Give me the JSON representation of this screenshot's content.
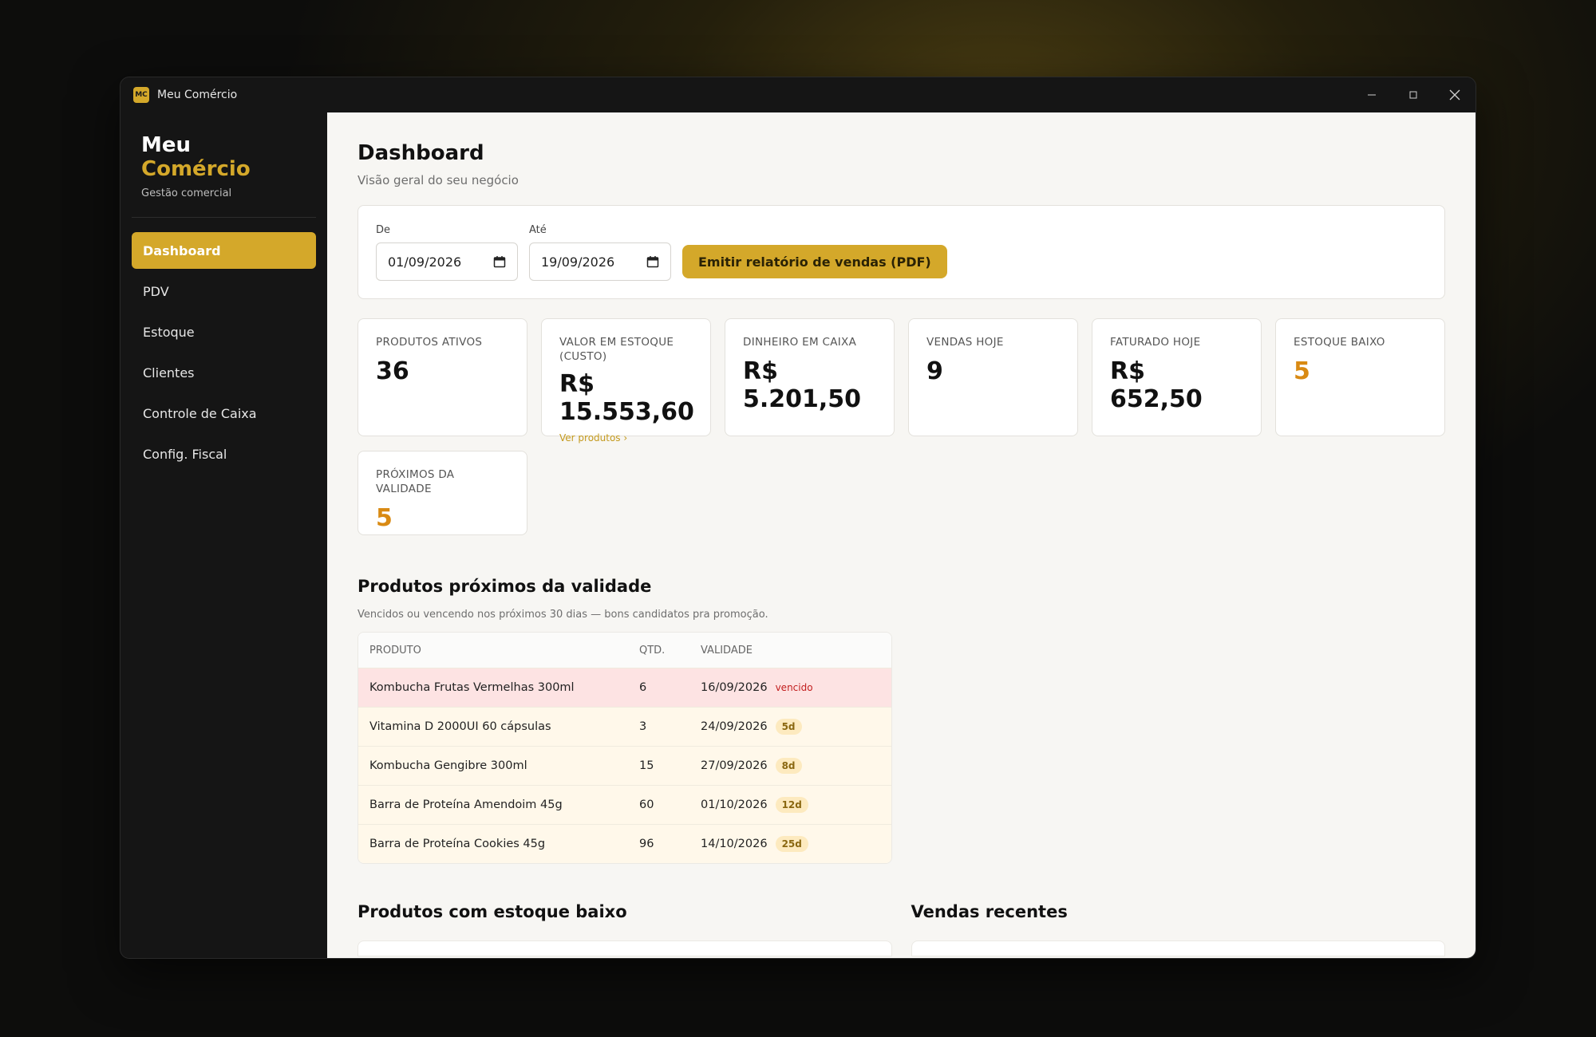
{
  "window": {
    "title": "Meu Comércio",
    "badge": "MC"
  },
  "sidebar": {
    "brand_main": "Meu",
    "brand_accent": "Comércio",
    "subtitle": "Gestão comercial",
    "items": [
      {
        "label": "Dashboard",
        "active": true
      },
      {
        "label": "PDV"
      },
      {
        "label": "Estoque"
      },
      {
        "label": "Clientes"
      },
      {
        "label": "Controle de Caixa"
      },
      {
        "label": "Config. Fiscal"
      }
    ]
  },
  "page": {
    "title": "Dashboard",
    "subtitle": "Visão geral do seu negócio"
  },
  "filters": {
    "from_label": "De",
    "from_value": "01/09/2026",
    "to_label": "Até",
    "to_value": "19/09/2026",
    "pdf_button": "Emitir relatório de vendas (PDF)"
  },
  "kpis": [
    {
      "label": "PRODUTOS ATIVOS",
      "value": "36"
    },
    {
      "label": "VALOR EM ESTOQUE (CUSTO)",
      "value": "R$ 15.553,60",
      "link": "Ver produtos ›"
    },
    {
      "label": "DINHEIRO EM CAIXA",
      "value": "R$ 5.201,50"
    },
    {
      "label": "VENDAS HOJE",
      "value": "9"
    },
    {
      "label": "FATURADO HOJE",
      "value": "R$ 652,50"
    },
    {
      "label": "ESTOQUE BAIXO",
      "value": "5"
    },
    {
      "label": "PRÓXIMOS DA VALIDADE",
      "value": "5"
    }
  ],
  "expiry": {
    "title": "Produtos próximos da validade",
    "subtitle": "Vencidos ou vencendo nos próximos 30 dias — bons candidatos pra promoção.",
    "headers": [
      "PRODUTO",
      "QTD.",
      "VALIDADE"
    ],
    "rows": [
      {
        "product": "Kombucha Frutas Vermelhas 300ml",
        "qty": "6",
        "date": "16/09/2026",
        "tag": "vencido"
      },
      {
        "product": "Vitamina D 2000UI 60 cápsulas",
        "qty": "3",
        "date": "24/09/2026",
        "tag": "5d"
      },
      {
        "product": "Kombucha Gengibre 300ml",
        "qty": "15",
        "date": "27/09/2026",
        "tag": "8d"
      },
      {
        "product": "Barra de Proteína Amendoim 45g",
        "qty": "60",
        "date": "01/10/2026",
        "tag": "12d"
      },
      {
        "product": "Barra de Proteína Cookies 45g",
        "qty": "96",
        "date": "14/10/2026",
        "tag": "25d"
      }
    ]
  },
  "bottom": {
    "low_stock_title": "Produtos com estoque baixo",
    "recent_sales_title": "Vendas recentes"
  }
}
